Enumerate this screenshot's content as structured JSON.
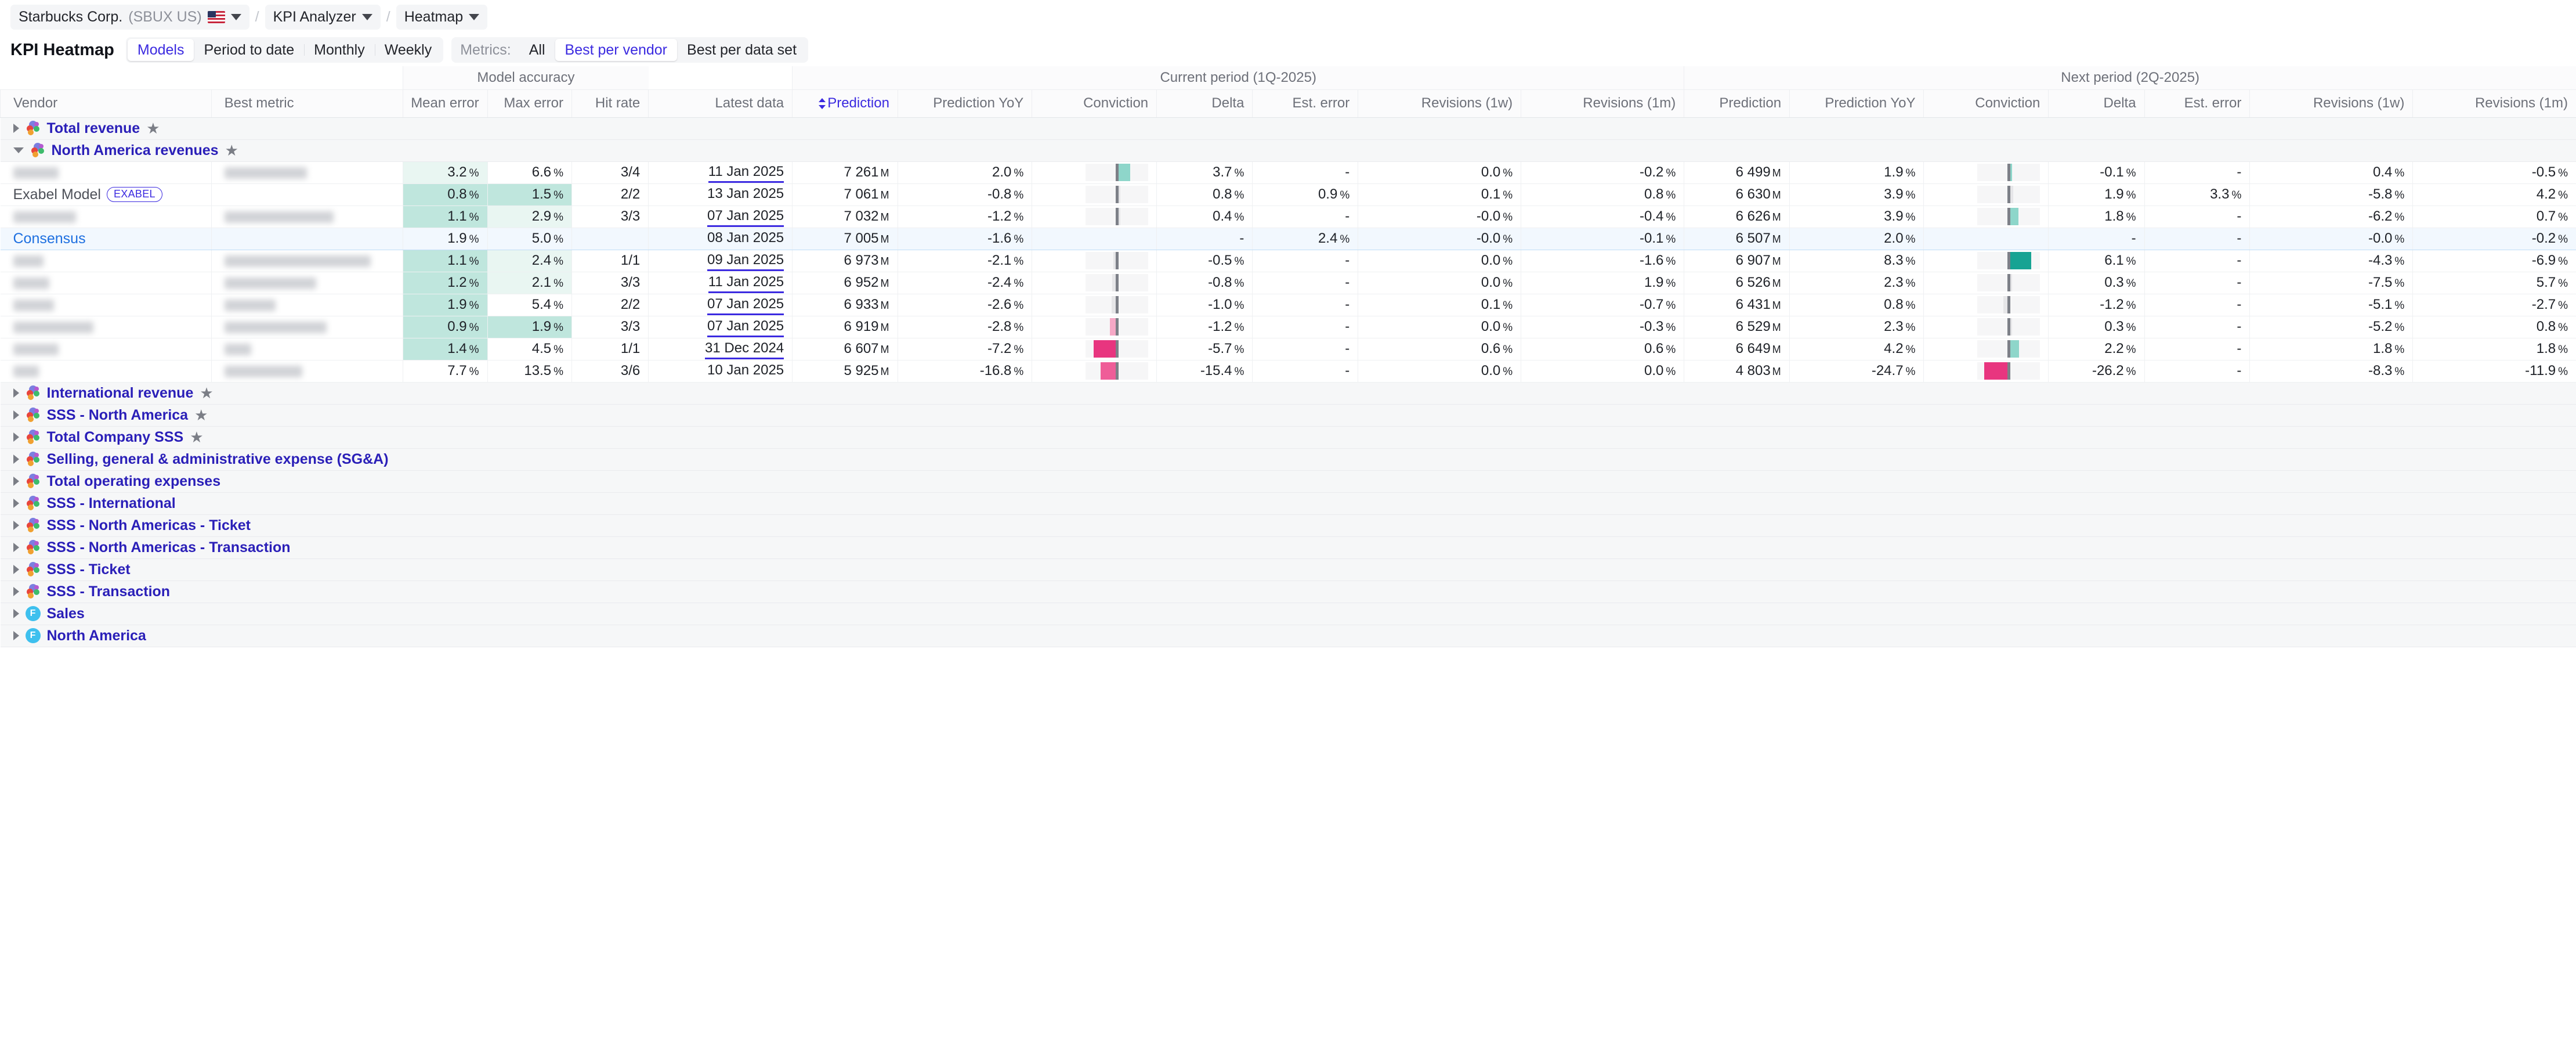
{
  "breadcrumb": {
    "company": "Starbucks Corp.",
    "ticker": "(SBUX US)",
    "app": "KPI Analyzer",
    "view": "Heatmap",
    "separator": "/"
  },
  "toolbar": {
    "title": "KPI Heatmap",
    "view_tabs": [
      {
        "label": "Models",
        "active": true
      },
      {
        "label": "Period to date",
        "active": false
      },
      {
        "label": "Monthly",
        "active": false
      },
      {
        "label": "Weekly",
        "active": false
      }
    ],
    "metrics_label": "Metrics:",
    "metric_tabs": [
      {
        "label": "All",
        "active": false
      },
      {
        "label": "Best per vendor",
        "active": true
      },
      {
        "label": "Best per data set",
        "active": false
      }
    ]
  },
  "table": {
    "group_headers": [
      {
        "label": "",
        "span": 2
      },
      {
        "label": "Model accuracy",
        "span": 3
      },
      {
        "label": "",
        "span": 1
      },
      {
        "label": "Current period (1Q-2025)",
        "span": 7
      },
      {
        "label": "Next period (2Q-2025)",
        "span": 7
      }
    ],
    "columns": [
      {
        "label": "Vendor",
        "align": "left"
      },
      {
        "label": "Best metric",
        "align": "left"
      },
      {
        "label": "Mean error",
        "align": "right"
      },
      {
        "label": "Max error",
        "align": "right"
      },
      {
        "label": "Hit rate",
        "align": "right"
      },
      {
        "label": "Latest data",
        "align": "right"
      },
      {
        "label": "Prediction",
        "align": "right",
        "sorted": true
      },
      {
        "label": "Prediction YoY",
        "align": "right"
      },
      {
        "label": "Conviction",
        "align": "right"
      },
      {
        "label": "Delta",
        "align": "right"
      },
      {
        "label": "Est. error",
        "align": "right"
      },
      {
        "label": "Revisions (1w)",
        "align": "right"
      },
      {
        "label": "Revisions (1m)",
        "align": "right"
      },
      {
        "label": "Prediction",
        "align": "right"
      },
      {
        "label": "Prediction YoY",
        "align": "right"
      },
      {
        "label": "Conviction",
        "align": "right"
      },
      {
        "label": "Delta",
        "align": "right"
      },
      {
        "label": "Est. error",
        "align": "right"
      },
      {
        "label": "Revisions (1w)",
        "align": "right"
      },
      {
        "label": "Revisions (1m)",
        "align": "right"
      }
    ],
    "rows": [
      {
        "kind": "group",
        "label": "Total revenue",
        "icon": "kpi-cluster-icon",
        "expanded": false,
        "starred": true
      },
      {
        "kind": "group",
        "label": "North America revenues",
        "icon": "kpi-cluster-icon",
        "expanded": true,
        "starred": true
      },
      {
        "kind": "data",
        "vendor": "",
        "vendor_redacted": true,
        "vendor_w": 78,
        "metric": "",
        "metric_redacted": true,
        "metric_w": 142,
        "mean_error": "3.2 %",
        "mean_heat": 0.18,
        "max_error": "6.6 %",
        "max_heat": 0,
        "hit_rate": "3/4",
        "latest_data": "11 Jan 2025",
        "latest_underline": true,
        "c_prediction": "7 261",
        "c_unit": "M",
        "c_pred_yoy": "2.0 %",
        "c_conv": 0.42,
        "c_conv_dir": "up",
        "c_delta": "3.7 %",
        "c_est_error": "-",
        "c_rev1w": "0.0 %",
        "c_rev1m": "-0.2 %",
        "n_prediction": "6 499",
        "n_unit": "M",
        "n_pred_yoy": "1.9 %",
        "n_conv": 0.0,
        "n_conv_dir": "up",
        "n_delta": "-0.1 %",
        "n_est_error": "-",
        "n_rev1w": "0.4 %",
        "n_rev1m": "-0.5 %"
      },
      {
        "kind": "data",
        "vendor": "Exabel Model",
        "vendor_redacted": false,
        "chip": "EXABEL",
        "metric": "",
        "metric_redacted": false,
        "metric_w": 0,
        "mean_error": "0.8 %",
        "mean_heat": 0.62,
        "max_error": "1.5 %",
        "max_heat": 0.62,
        "hit_rate": "2/2",
        "latest_data": "13 Jan 2025",
        "latest_underline": false,
        "c_prediction": "7 061",
        "c_unit": "M",
        "c_pred_yoy": "-0.8 %",
        "c_conv": 0.12,
        "c_conv_dir": "grey-up",
        "c_delta": "0.8 %",
        "c_est_error": "0.9 %",
        "c_rev1w": "0.1 %",
        "c_rev1m": "0.8 %",
        "n_prediction": "6 630",
        "n_unit": "M",
        "n_pred_yoy": "3.9 %",
        "n_conv": 0.14,
        "n_conv_dir": "grey-up",
        "n_delta": "1.9 %",
        "n_est_error": "3.3 %",
        "n_rev1w": "-5.8 %",
        "n_rev1m": "4.2 %"
      },
      {
        "kind": "data",
        "vendor": "",
        "vendor_redacted": true,
        "vendor_w": 108,
        "metric": "",
        "metric_redacted": true,
        "metric_w": 188,
        "mean_error": "1.1 %",
        "mean_heat": 0.62,
        "max_error": "2.9 %",
        "max_heat": 0.18,
        "hit_rate": "3/3",
        "latest_data": "07 Jan 2025",
        "latest_underline": true,
        "c_prediction": "7 032",
        "c_unit": "M",
        "c_pred_yoy": "-1.2 %",
        "c_conv": 0.07,
        "c_conv_dir": "grey-up",
        "c_delta": "0.4 %",
        "c_est_error": "-",
        "c_rev1w": "-0.0 %",
        "c_rev1m": "-0.4 %",
        "n_prediction": "6 626",
        "n_unit": "M",
        "n_pred_yoy": "3.9 %",
        "n_conv": 0.32,
        "n_conv_dir": "up",
        "n_delta": "1.8 %",
        "n_est_error": "-",
        "n_rev1w": "-6.2 %",
        "n_rev1m": "0.7 %"
      },
      {
        "kind": "data",
        "consensus": true,
        "vendor": "Consensus",
        "vendor_redacted": false,
        "metric": "",
        "metric_redacted": false,
        "metric_w": 0,
        "mean_error": "1.9 %",
        "mean_heat": 0,
        "max_error": "5.0 %",
        "max_heat": 0,
        "hit_rate": "",
        "latest_data": "08 Jan 2025",
        "latest_underline": false,
        "c_prediction": "7 005",
        "c_unit": "M",
        "c_pred_yoy": "-1.6 %",
        "c_conv": null,
        "c_conv_dir": "none",
        "c_delta": "-",
        "c_est_error": "2.4 %",
        "c_rev1w": "-0.0 %",
        "c_rev1m": "-0.1 %",
        "n_prediction": "6 507",
        "n_unit": "M",
        "n_pred_yoy": "2.0 %",
        "n_conv": null,
        "n_conv_dir": "none",
        "n_delta": "-",
        "n_est_error": "-",
        "n_rev1w": "-0.0 %",
        "n_rev1m": "-0.2 %"
      },
      {
        "kind": "data",
        "vendor": "",
        "vendor_redacted": true,
        "vendor_w": 52,
        "metric": "",
        "metric_redacted": true,
        "metric_w": 252,
        "mean_error": "1.1 %",
        "mean_heat": 0.62,
        "max_error": "2.4 %",
        "max_heat": 0.18,
        "hit_rate": "1/1",
        "latest_data": "09 Jan 2025",
        "latest_underline": true,
        "c_prediction": "6 973",
        "c_unit": "M",
        "c_pred_yoy": "-2.1 %",
        "c_conv": 0.09,
        "c_conv_dir": "grey-dn",
        "c_delta": "-0.5 %",
        "c_est_error": "-",
        "c_rev1w": "0.0 %",
        "c_rev1m": "-1.6 %",
        "n_prediction": "6 907",
        "n_unit": "M",
        "n_pred_yoy": "8.3 %",
        "n_conv": 0.72,
        "n_conv_dir": "up-strong",
        "n_delta": "6.1 %",
        "n_est_error": "-",
        "n_rev1w": "-4.3 %",
        "n_rev1m": "-6.9 %"
      },
      {
        "kind": "data",
        "vendor": "",
        "vendor_redacted": true,
        "vendor_w": 62,
        "metric": "",
        "metric_redacted": true,
        "metric_w": 158,
        "mean_error": "1.2 %",
        "mean_heat": 0.62,
        "max_error": "2.1 %",
        "max_heat": 0.18,
        "hit_rate": "3/3",
        "latest_data": "11 Jan 2025",
        "latest_underline": true,
        "c_prediction": "6 952",
        "c_unit": "M",
        "c_pred_yoy": "-2.4 %",
        "c_conv": 0.14,
        "c_conv_dir": "grey-dn",
        "c_delta": "-0.8 %",
        "c_est_error": "-",
        "c_rev1w": "0.0 %",
        "c_rev1m": "1.9 %",
        "n_prediction": "6 526",
        "n_unit": "M",
        "n_pred_yoy": "2.3 %",
        "n_conv": 0.07,
        "n_conv_dir": "grey-up",
        "n_delta": "0.3 %",
        "n_est_error": "-",
        "n_rev1w": "-7.5 %",
        "n_rev1m": "5.7 %"
      },
      {
        "kind": "data",
        "vendor": "",
        "vendor_redacted": true,
        "vendor_w": 70,
        "metric": "",
        "metric_redacted": true,
        "metric_w": 88,
        "mean_error": "1.9 %",
        "mean_heat": 0.62,
        "max_error": "5.4 %",
        "max_heat": 0,
        "hit_rate": "2/2",
        "latest_data": "07 Jan 2025",
        "latest_underline": true,
        "c_prediction": "6 933",
        "c_unit": "M",
        "c_pred_yoy": "-2.6 %",
        "c_conv": 0.16,
        "c_conv_dir": "grey-dn",
        "c_delta": "-1.0 %",
        "c_est_error": "-",
        "c_rev1w": "0.1 %",
        "c_rev1m": "-0.7 %",
        "n_prediction": "6 431",
        "n_unit": "M",
        "n_pred_yoy": "0.8 %",
        "n_conv": 0.17,
        "n_conv_dir": "grey-dn",
        "n_delta": "-1.2 %",
        "n_est_error": "-",
        "n_rev1w": "-5.1 %",
        "n_rev1m": "-2.7 %"
      },
      {
        "kind": "data",
        "vendor": "",
        "vendor_redacted": true,
        "vendor_w": 138,
        "metric": "",
        "metric_redacted": true,
        "metric_w": 176,
        "mean_error": "0.9 %",
        "mean_heat": 0.62,
        "max_error": "1.9 %",
        "max_heat": 0.62,
        "hit_rate": "3/3",
        "latest_data": "07 Jan 2025",
        "latest_underline": true,
        "c_prediction": "6 919",
        "c_unit": "M",
        "c_pred_yoy": "-2.8 %",
        "c_conv": 0.22,
        "c_conv_dir": "dn",
        "c_delta": "-1.2 %",
        "c_est_error": "-",
        "c_rev1w": "0.0 %",
        "c_rev1m": "-0.3 %",
        "n_prediction": "6 529",
        "n_unit": "M",
        "n_pred_yoy": "2.3 %",
        "n_conv": 0.06,
        "n_conv_dir": "grey-up",
        "n_delta": "0.3 %",
        "n_est_error": "-",
        "n_rev1w": "-5.2 %",
        "n_rev1m": "0.8 %"
      },
      {
        "kind": "data",
        "vendor": "",
        "vendor_redacted": true,
        "vendor_w": 78,
        "metric": "",
        "metric_redacted": true,
        "metric_w": 46,
        "mean_error": "1.4 %",
        "mean_heat": 0.62,
        "max_error": "4.5 %",
        "max_heat": 0,
        "hit_rate": "1/1",
        "latest_data": "31 Dec 2024",
        "latest_underline": true,
        "c_prediction": "6 607",
        "c_unit": "M",
        "c_pred_yoy": "-7.2 %",
        "c_conv": 0.74,
        "c_conv_dir": "dn-strong",
        "c_delta": "-5.7 %",
        "c_est_error": "-",
        "c_rev1w": "0.6 %",
        "c_rev1m": "0.6 %",
        "n_prediction": "6 649",
        "n_unit": "M",
        "n_pred_yoy": "4.2 %",
        "n_conv": 0.34,
        "n_conv_dir": "up",
        "n_delta": "2.2 %",
        "n_est_error": "-",
        "n_rev1w": "1.8 %",
        "n_rev1m": "1.8 %"
      },
      {
        "kind": "data",
        "vendor": "",
        "vendor_redacted": true,
        "vendor_w": 44,
        "metric": "",
        "metric_redacted": true,
        "metric_w": 134,
        "mean_error": "7.7 %",
        "mean_heat": 0,
        "max_error": "13.5 %",
        "max_heat": 0,
        "hit_rate": "3/6",
        "latest_data": "10 Jan 2025",
        "latest_underline": false,
        "c_prediction": "5 925",
        "c_unit": "M",
        "c_pred_yoy": "-16.8 %",
        "c_conv": 0.52,
        "c_conv_dir": "dn-mid",
        "c_delta": "-15.4 %",
        "c_est_error": "-",
        "c_rev1w": "0.0 %",
        "c_rev1m": "0.0 %",
        "n_prediction": "4 803",
        "n_unit": "M",
        "n_pred_yoy": "-24.7 %",
        "n_conv": 0.78,
        "n_conv_dir": "dn-strong",
        "n_delta": "-26.2 %",
        "n_est_error": "-",
        "n_rev1w": "-8.3 %",
        "n_rev1m": "-11.9 %"
      },
      {
        "kind": "group",
        "label": "International revenue",
        "icon": "kpi-cluster-icon",
        "expanded": false,
        "starred": true
      },
      {
        "kind": "group",
        "label": "SSS - North America",
        "icon": "kpi-cluster-icon",
        "expanded": false,
        "starred": true
      },
      {
        "kind": "group",
        "label": "Total Company SSS",
        "icon": "kpi-cluster-icon",
        "expanded": false,
        "starred": true
      },
      {
        "kind": "group",
        "label": "Selling, general & administrative expense (SG&A)",
        "icon": "kpi-cluster-icon",
        "expanded": false,
        "starred": false
      },
      {
        "kind": "group",
        "label": "Total operating expenses",
        "icon": "kpi-cluster-icon",
        "expanded": false,
        "starred": false
      },
      {
        "kind": "group",
        "label": "SSS - International",
        "icon": "kpi-cluster-icon",
        "expanded": false,
        "starred": false
      },
      {
        "kind": "group",
        "label": "SSS - North Americas - Ticket",
        "icon": "kpi-cluster-icon",
        "expanded": false,
        "starred": false
      },
      {
        "kind": "group",
        "label": "SSS - North Americas - Transaction",
        "icon": "kpi-cluster-icon",
        "expanded": false,
        "starred": false
      },
      {
        "kind": "group",
        "label": "SSS - Ticket",
        "icon": "kpi-cluster-icon",
        "expanded": false,
        "starred": false
      },
      {
        "kind": "group",
        "label": "SSS - Transaction",
        "icon": "kpi-cluster-icon",
        "expanded": false,
        "starred": false
      },
      {
        "kind": "group",
        "label": "Sales",
        "icon": "factset-badge-icon",
        "badge_letter": "F",
        "expanded": false,
        "starred": false
      },
      {
        "kind": "group",
        "label": "North America",
        "icon": "factset-badge-icon",
        "badge_letter": "F",
        "expanded": false,
        "starred": false
      }
    ]
  },
  "colors": {
    "accent": "#3b2ae0",
    "group_label": "#2a1fb8",
    "consensus_text": "#1d6fe0",
    "consensus_bg": "#f2f8fe",
    "heat_green_strong": "#bfe6dd",
    "heat_green_light": "#e9f6f2",
    "conv_teal": "#8ed6ca",
    "conv_teal_strong": "#17a393",
    "conv_pink": "#f6a8c6",
    "conv_pink_strong": "#e8357f",
    "conv_grey": "#e6e6e8",
    "conv_track": "#f6f6f7",
    "badge_cyan": "#3ec0ee"
  }
}
